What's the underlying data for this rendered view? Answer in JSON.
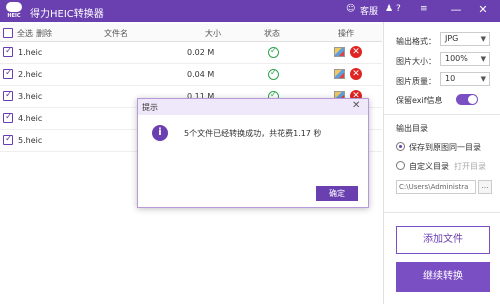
{
  "app": {
    "logo_text": "HEIC",
    "title": "得力HEIC转换器",
    "kefu": "客服",
    "help": "?",
    "minimize": "—",
    "close": "✕"
  },
  "table": {
    "headers": {
      "select_all": "全选",
      "delete": "删除",
      "filename": "文件名",
      "size": "大小",
      "status": "状态",
      "action": "操作"
    },
    "rows": [
      {
        "name": "1.heic",
        "size": "0.02 M"
      },
      {
        "name": "2.heic",
        "size": "0.04 M"
      },
      {
        "name": "3.heic",
        "size": "0.11 M"
      },
      {
        "name": "4.heic",
        "size": ""
      },
      {
        "name": "5.heic",
        "size": ""
      }
    ]
  },
  "settings": {
    "format_label": "输出格式：",
    "format_value": "JPG",
    "size_label": "图片大小：",
    "size_value": "100%",
    "quality_label": "图片质量：",
    "quality_value": "10",
    "exif_label": "保留exif信息",
    "output_title": "输出目录",
    "opt_same": "保存到原图同一目录",
    "opt_custom": "自定义目录",
    "open_dir": "打开目录",
    "path": "C:\\Users\\Administra",
    "path_btn": "...",
    "add_files": "添加文件",
    "convert": "继续转换"
  },
  "dialog": {
    "title": "提示",
    "close": "✕",
    "icon": "i",
    "message": "5个文件已经转换成功，共花费1.17 秒",
    "ok": "确定"
  },
  "colors": {
    "brand": "#6a3fb0",
    "button": "#7b4fc4",
    "success": "#2ea44f",
    "danger": "#e02424"
  }
}
